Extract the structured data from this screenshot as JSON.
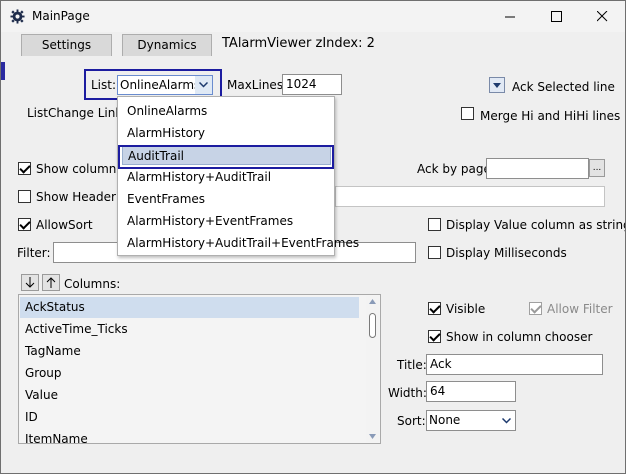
{
  "window": {
    "title": "MainPage",
    "minimize_glyph": "—",
    "maximize_glyph": "☐",
    "close_glyph": "✕"
  },
  "tabs": {
    "settings": "Settings",
    "dynamics": "Dynamics"
  },
  "header": "TAlarmViewer zIndex: 2",
  "list_label": "List:",
  "list_value": "OnlineAlarms",
  "maxlines_label": "MaxLines:",
  "maxlines_value": "1024",
  "ack_selected": "Ack Selected line",
  "listchange_label": "ListChange Link:",
  "merge_label": "Merge Hi and HiHi lines",
  "show_column_label": "Show column ti",
  "ack_by_page_label": "Ack by page:",
  "ack_by_page_value": "",
  "ellipsis": "...",
  "show_header_label": "Show Header:",
  "allowsort_label": "AllowSort",
  "display_value_label": "Display Value column as string",
  "filter_label": "Filter:",
  "filter_value": "",
  "display_ms_label": "Display Milliseconds",
  "columns_label": "Columns:",
  "dropdown_options": [
    "OnlineAlarms",
    "AlarmHistory",
    "AuditTrail",
    "AlarmHistory+AuditTrail",
    "EventFrames",
    "AlarmHistory+EventFrames",
    "AlarmHistory+AuditTrail+EventFrames"
  ],
  "dropdown_selected": "AuditTrail",
  "columns": [
    "AckStatus",
    "ActiveTime_Ticks",
    "TagName",
    "Group",
    "Value",
    "ID",
    "ItemName"
  ],
  "columns_selected": "AckStatus",
  "visible_label": "Visible",
  "allow_filter_label": "Allow Filter",
  "column_chooser_label": "Show in column chooser",
  "title_label": "Title:",
  "title_value": "Ack",
  "width_label": "Width:",
  "width_value": "64",
  "sort_label": "Sort:",
  "sort_value": "None",
  "colors": {
    "accent_highlight": "#1c1ca0",
    "selection": "#c7d3e6"
  }
}
